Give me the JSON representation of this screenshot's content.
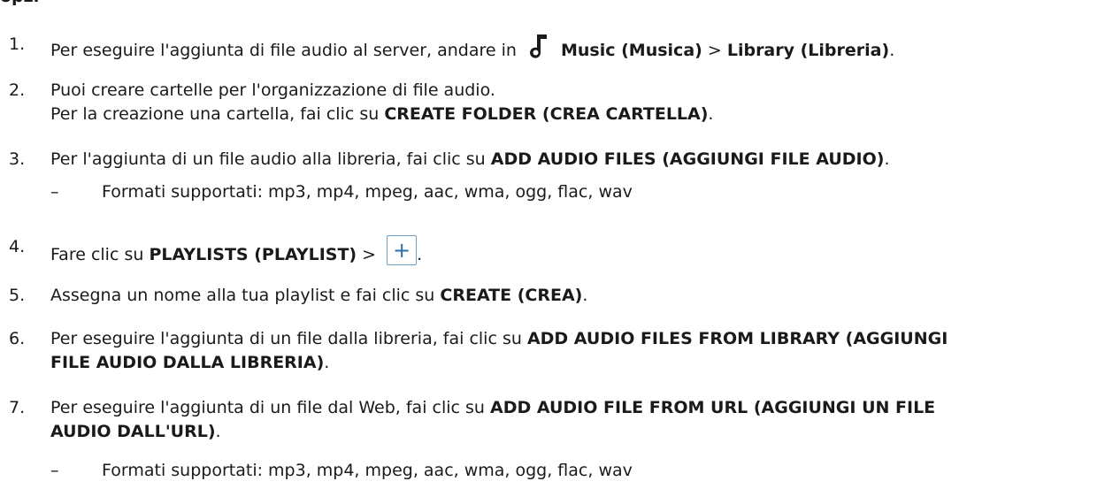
{
  "header_fragment": "opzi",
  "steps": [
    {
      "num": "1.",
      "pre": "Per eseguire l'aggiunta di file audio al server, andare in",
      "b1": "Music (Musica)",
      "sep": ">",
      "b2": "Library (Libreria)",
      "post": "."
    },
    {
      "num": "2.",
      "line1": "Puoi creare cartelle per l'organizzazione di file audio.",
      "pre": "Per la creazione una cartella, fai clic su",
      "b1": "CREATE FOLDER (CREA CARTELLA)",
      "post": "."
    },
    {
      "num": "3.",
      "pre": "Per l'aggiunta di un file audio alla libreria, fai clic su",
      "b1": "ADD AUDIO FILES (AGGIUNGI FILE AUDIO)",
      "post": ".",
      "sub_dash": "–",
      "sub": "Formati supportati: mp3, mp4, mpeg, aac, wma, ogg, flac, wav"
    },
    {
      "num": "4.",
      "pre": "Fare clic su",
      "b1": "PLAYLISTS (PLAYLIST)",
      "sep": ">",
      "button": "+",
      "post": "."
    },
    {
      "num": "5.",
      "pre": "Assegna un nome alla tua playlist e fai clic su",
      "b1": "CREATE (CREA)",
      "post": "."
    },
    {
      "num": "6.",
      "pre": "Per eseguire l'aggiunta di un file dalla libreria, fai clic su",
      "b1": "ADD AUDIO FILES FROM LIBRARY (AGGIUNGI",
      "b2": "FILE AUDIO DALLA LIBRERIA)",
      "post": "."
    },
    {
      "num": "7.",
      "pre": "Per eseguire l'aggiunta di un file dal Web, fai clic su",
      "b1": "ADD AUDIO FILE FROM URL (AGGIUNGI UN FILE",
      "b2": "AUDIO DALL'URL)",
      "post": ".",
      "sub_dash": "–",
      "sub": "Formati supportati: mp3, mp4, mpeg, aac, wma, ogg, flac, wav"
    }
  ],
  "icons": {
    "step1": "music-note-icon",
    "step4": "plus-icon"
  },
  "colors": {
    "text": "#1a1a1a",
    "button_border": "#6a9fc6",
    "button_plus": "#2a6fa8"
  }
}
